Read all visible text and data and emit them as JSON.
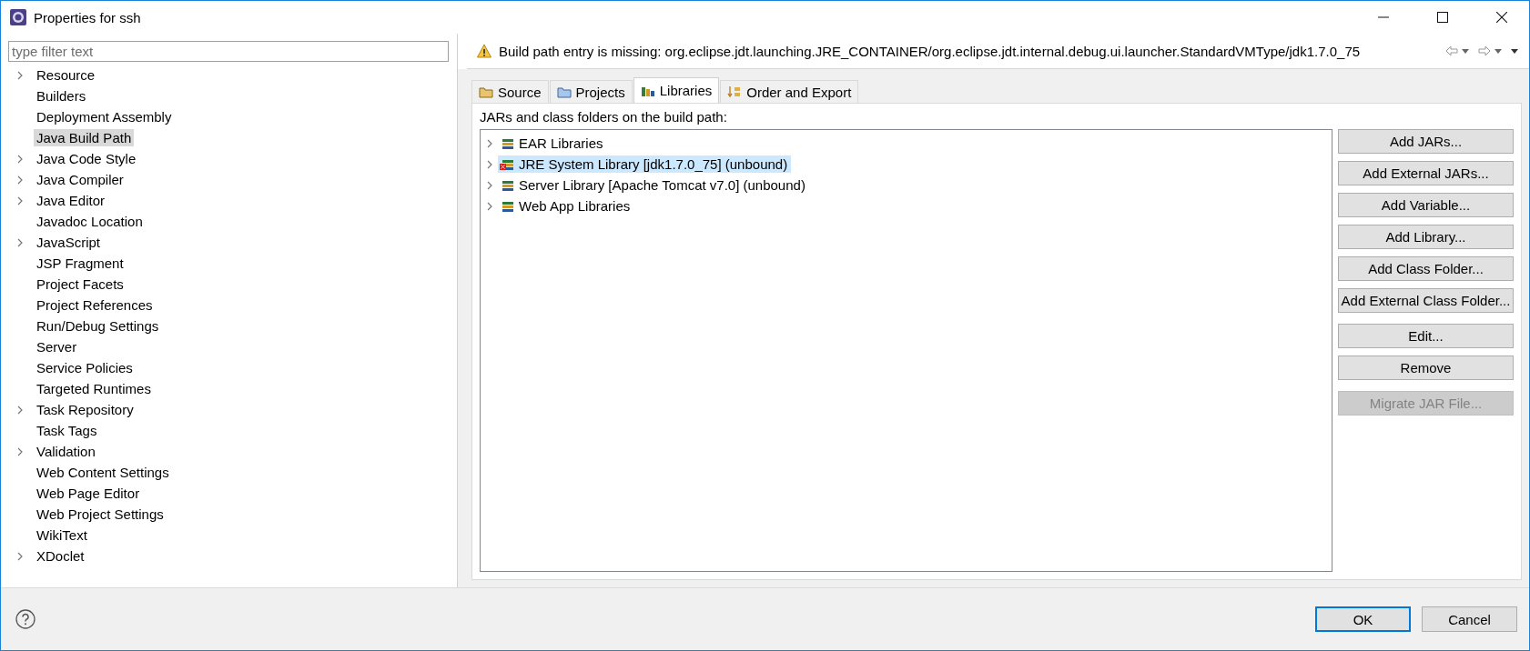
{
  "window": {
    "title": "Properties for ssh"
  },
  "filter": {
    "placeholder": "type filter text"
  },
  "sidebar": {
    "items": [
      {
        "label": "Resource",
        "expandable": true,
        "selected": false
      },
      {
        "label": "Builders",
        "expandable": false,
        "selected": false
      },
      {
        "label": "Deployment Assembly",
        "expandable": false,
        "selected": false
      },
      {
        "label": "Java Build Path",
        "expandable": false,
        "selected": true
      },
      {
        "label": "Java Code Style",
        "expandable": true,
        "selected": false
      },
      {
        "label": "Java Compiler",
        "expandable": true,
        "selected": false
      },
      {
        "label": "Java Editor",
        "expandable": true,
        "selected": false
      },
      {
        "label": "Javadoc Location",
        "expandable": false,
        "selected": false
      },
      {
        "label": "JavaScript",
        "expandable": true,
        "selected": false
      },
      {
        "label": "JSP Fragment",
        "expandable": false,
        "selected": false
      },
      {
        "label": "Project Facets",
        "expandable": false,
        "selected": false
      },
      {
        "label": "Project References",
        "expandable": false,
        "selected": false
      },
      {
        "label": "Run/Debug Settings",
        "expandable": false,
        "selected": false
      },
      {
        "label": "Server",
        "expandable": false,
        "selected": false
      },
      {
        "label": "Service Policies",
        "expandable": false,
        "selected": false
      },
      {
        "label": "Targeted Runtimes",
        "expandable": false,
        "selected": false
      },
      {
        "label": "Task Repository",
        "expandable": true,
        "selected": false
      },
      {
        "label": "Task Tags",
        "expandable": false,
        "selected": false
      },
      {
        "label": "Validation",
        "expandable": true,
        "selected": false
      },
      {
        "label": "Web Content Settings",
        "expandable": false,
        "selected": false
      },
      {
        "label": "Web Page Editor",
        "expandable": false,
        "selected": false
      },
      {
        "label": "Web Project Settings",
        "expandable": false,
        "selected": false
      },
      {
        "label": "WikiText",
        "expandable": false,
        "selected": false
      },
      {
        "label": "XDoclet",
        "expandable": true,
        "selected": false
      }
    ]
  },
  "message": {
    "text": "Build path entry is missing: org.eclipse.jdt.launching.JRE_CONTAINER/org.eclipse.jdt.internal.debug.ui.launcher.StandardVMType/jdk1.7.0_75"
  },
  "tabs": [
    {
      "label": "Source",
      "selected": false
    },
    {
      "label": "Projects",
      "selected": false
    },
    {
      "label": "Libraries",
      "selected": true
    },
    {
      "label": "Order and Export",
      "selected": false
    }
  ],
  "libraries": {
    "caption": "JARs and class folders on the build path:",
    "items": [
      {
        "label": "EAR Libraries",
        "selected": false,
        "error": false
      },
      {
        "label": "JRE System Library [jdk1.7.0_75] (unbound)",
        "selected": true,
        "error": true
      },
      {
        "label": "Server Library [Apache Tomcat v7.0] (unbound)",
        "selected": false,
        "error": false
      },
      {
        "label": "Web App Libraries",
        "selected": false,
        "error": false
      }
    ]
  },
  "button_groups": [
    [
      {
        "label": "Add JARs...",
        "disabled": false
      },
      {
        "label": "Add External JARs...",
        "disabled": false
      },
      {
        "label": "Add Variable...",
        "disabled": false
      },
      {
        "label": "Add Library...",
        "disabled": false
      },
      {
        "label": "Add Class Folder...",
        "disabled": false
      },
      {
        "label": "Add External Class Folder...",
        "disabled": false
      }
    ],
    [
      {
        "label": "Edit...",
        "disabled": false
      },
      {
        "label": "Remove",
        "disabled": false
      }
    ],
    [
      {
        "label": "Migrate JAR File...",
        "disabled": true
      }
    ]
  ],
  "footer": {
    "buttons": [
      {
        "label": "OK",
        "default": true
      },
      {
        "label": "Cancel",
        "default": false
      }
    ]
  }
}
